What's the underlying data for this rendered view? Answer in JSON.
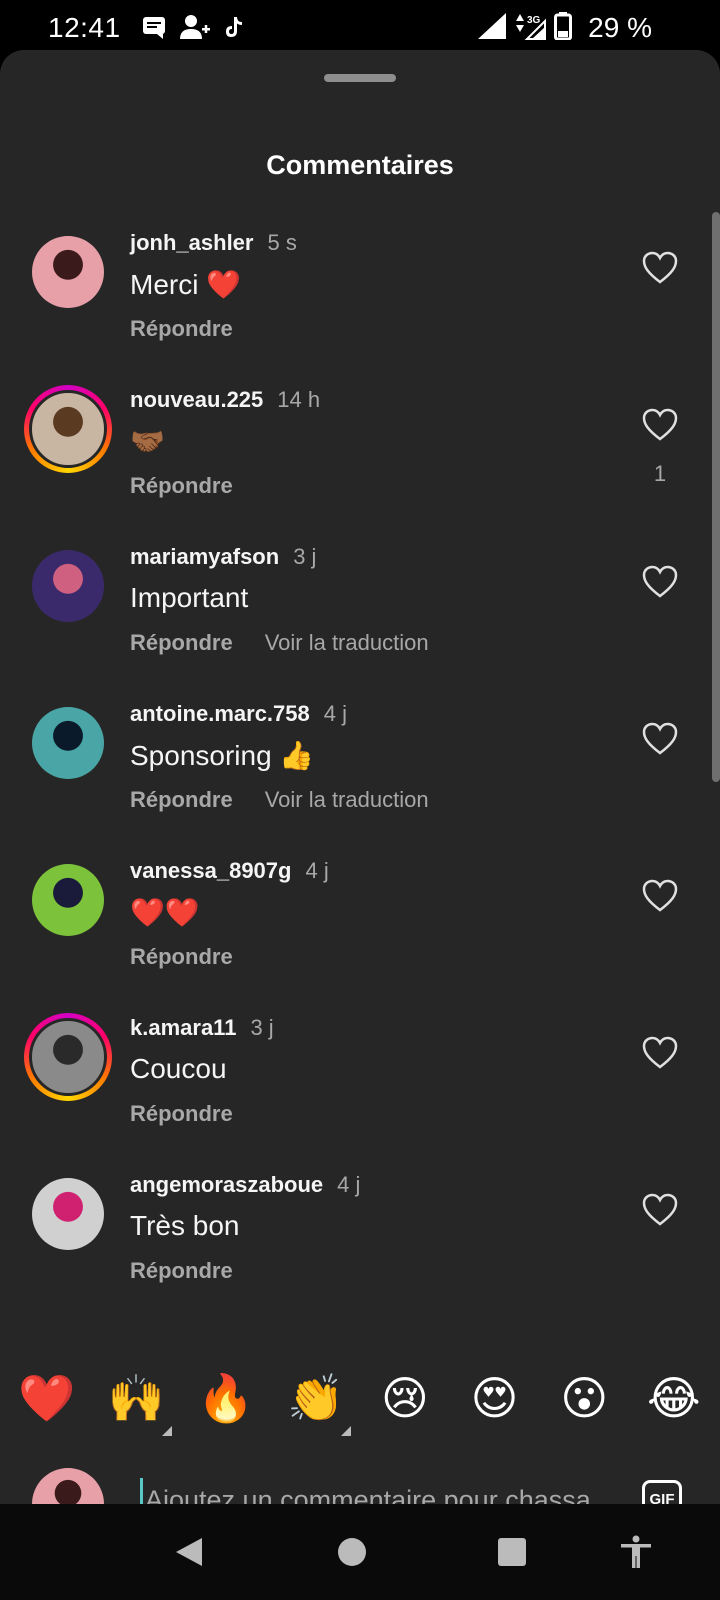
{
  "status_bar": {
    "time": "12:41",
    "battery": "29 %",
    "network": "3G",
    "left_icons": [
      "message-icon",
      "person-add-icon",
      "tiktok-icon"
    ],
    "right_icons": [
      "signal-icon",
      "data-3g-icon",
      "battery-icon"
    ]
  },
  "sheet": {
    "title": "Commentaires"
  },
  "comments": [
    {
      "username": "jonh_ashler",
      "time": "5 s",
      "text": "Merci ❤️",
      "reply": "Répondre",
      "translate": "",
      "likes": "",
      "ring": false,
      "avatar_colors": [
        "#e8a0a8",
        "#3a1a1a"
      ]
    },
    {
      "username": "nouveau.225",
      "time": "14 h",
      "text": "🤝🏾",
      "reply": "Répondre",
      "translate": "",
      "likes": "1",
      "ring": true,
      "avatar_colors": [
        "#c9b6a2",
        "#5a3a20"
      ]
    },
    {
      "username": "mariamyafson",
      "time": "3 j",
      "text": "Important",
      "reply": "Répondre",
      "translate": "Voir la traduction",
      "likes": "",
      "ring": false,
      "avatar_colors": [
        "#3b2a6b",
        "#d06080"
      ]
    },
    {
      "username": "antoine.marc.758",
      "time": "4 j",
      "text": "Sponsoring 👍",
      "reply": "Répondre",
      "translate": "Voir la traduction",
      "likes": "",
      "ring": false,
      "avatar_colors": [
        "#4aa6a6",
        "#0a1a2a"
      ]
    },
    {
      "username": "vanessa_8907g",
      "time": "4 j",
      "text": "❤️❤️",
      "reply": "Répondre",
      "translate": "",
      "likes": "",
      "ring": false,
      "avatar_colors": [
        "#7cc23a",
        "#1a1a3a"
      ]
    },
    {
      "username": "k.amara11",
      "time": "3 j",
      "text": "Coucou",
      "reply": "Répondre",
      "translate": "",
      "likes": "",
      "ring": true,
      "avatar_colors": [
        "#8a8a8a",
        "#2a2a2a"
      ]
    },
    {
      "username": "angemoraszaboue",
      "time": "4 j",
      "text": "Très bon",
      "reply": "Répondre",
      "translate": "",
      "likes": "",
      "ring": false,
      "avatar_colors": [
        "#d0d0d0",
        "#d02070"
      ]
    }
  ],
  "reactions": [
    {
      "emoji": "❤️",
      "more": false
    },
    {
      "emoji": "🙌",
      "more": true
    },
    {
      "emoji": "🔥",
      "more": false
    },
    {
      "emoji": "👏",
      "more": true
    },
    {
      "emoji": "😢",
      "more": false
    },
    {
      "emoji": "😍",
      "more": false
    },
    {
      "emoji": "😮",
      "more": false
    },
    {
      "emoji": "😂",
      "more": false
    }
  ],
  "composer": {
    "placeholder": "Ajoutez un commentaire pour chassa",
    "gif_label": "GIF"
  },
  "nav": {
    "icons": [
      "back-icon",
      "home-icon",
      "recents-icon",
      "accessibility-icon"
    ]
  },
  "colors": {
    "sheet_bg": "#262626",
    "secondary_text": "#a8a8a8",
    "cursor": "#5ac8c8"
  }
}
